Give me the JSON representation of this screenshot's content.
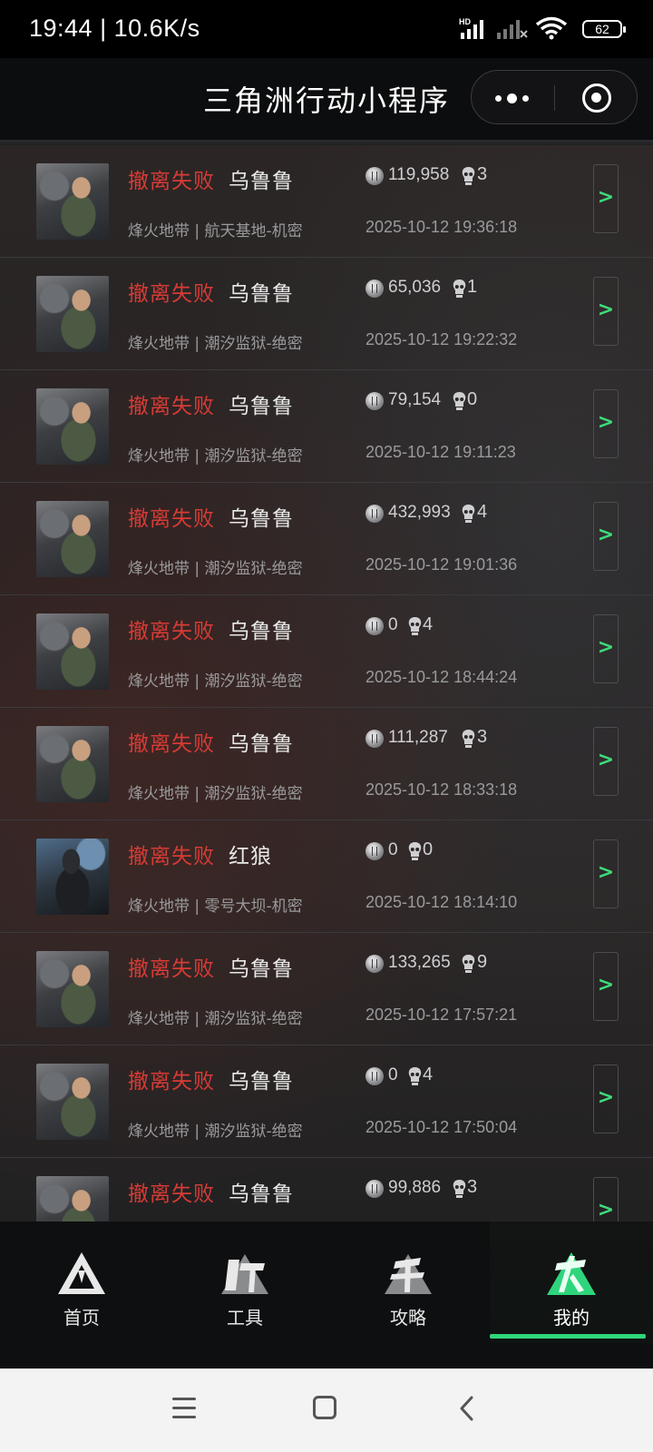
{
  "status_bar": {
    "time_speed": "19:44 | 10.6K/s",
    "battery": "62",
    "network_badge": "HD",
    "icons": [
      "signal-icon",
      "signal-no-service-icon",
      "wifi-icon",
      "battery-icon"
    ]
  },
  "header": {
    "title": "三角洲行动小程序",
    "icons": [
      "more-icon",
      "close-miniprogram-icon"
    ]
  },
  "records": [
    {
      "result": "撤离失败",
      "operator": "乌鲁鲁",
      "mode": "烽火地带 | 航天基地-机密",
      "value": "119,958",
      "kills": "3",
      "time": "2025-10-12 19:36:18",
      "detail": ">"
    },
    {
      "result": "撤离失败",
      "operator": "乌鲁鲁",
      "mode": "烽火地带 | 潮汐监狱-绝密",
      "value": "65,036",
      "kills": "1",
      "time": "2025-10-12 19:22:32",
      "detail": ">"
    },
    {
      "result": "撤离失败",
      "operator": "乌鲁鲁",
      "mode": "烽火地带 | 潮汐监狱-绝密",
      "value": "79,154",
      "kills": "0",
      "time": "2025-10-12 19:11:23",
      "detail": ">"
    },
    {
      "result": "撤离失败",
      "operator": "乌鲁鲁",
      "mode": "烽火地带 | 潮汐监狱-绝密",
      "value": "432,993",
      "kills": "4",
      "time": "2025-10-12 19:01:36",
      "detail": ">"
    },
    {
      "result": "撤离失败",
      "operator": "乌鲁鲁",
      "mode": "烽火地带 | 潮汐监狱-绝密",
      "value": "0",
      "kills": "4",
      "time": "2025-10-12 18:44:24",
      "detail": ">"
    },
    {
      "result": "撤离失败",
      "operator": "乌鲁鲁",
      "mode": "烽火地带 | 潮汐监狱-绝密",
      "value": "111,287",
      "kills": "3",
      "time": "2025-10-12 18:33:18",
      "detail": ">"
    },
    {
      "result": "撤离失败",
      "operator": "红狼",
      "mode": "烽火地带 | 零号大坝-机密",
      "value": "0",
      "kills": "0",
      "time": "2025-10-12 18:14:10",
      "detail": ">"
    },
    {
      "result": "撤离失败",
      "operator": "乌鲁鲁",
      "mode": "烽火地带 | 潮汐监狱-绝密",
      "value": "133,265",
      "kills": "9",
      "time": "2025-10-12 17:57:21",
      "detail": ">"
    },
    {
      "result": "撤离失败",
      "operator": "乌鲁鲁",
      "mode": "烽火地带 | 潮汐监狱-绝密",
      "value": "0",
      "kills": "4",
      "time": "2025-10-12 17:50:04",
      "detail": ">"
    },
    {
      "result": "撤离失败",
      "operator": "乌鲁鲁",
      "mode": "",
      "value": "99,886",
      "kills": "3",
      "time": "",
      "detail": ">"
    }
  ],
  "tabbar": {
    "tabs": [
      {
        "label": "首页",
        "icon": "home-logo-icon",
        "active": false
      },
      {
        "label": "工具",
        "icon": "tools-logo-icon",
        "active": false
      },
      {
        "label": "攻略",
        "icon": "guide-logo-icon",
        "active": false
      },
      {
        "label": "我的",
        "icon": "profile-logo-icon",
        "active": true
      }
    ]
  },
  "system_nav": {
    "icons": [
      "recent-apps-icon",
      "home-icon",
      "back-icon"
    ]
  },
  "colors": {
    "fail_red": "#d73b35",
    "accent_green": "#2fd57c",
    "background": "#151618"
  }
}
